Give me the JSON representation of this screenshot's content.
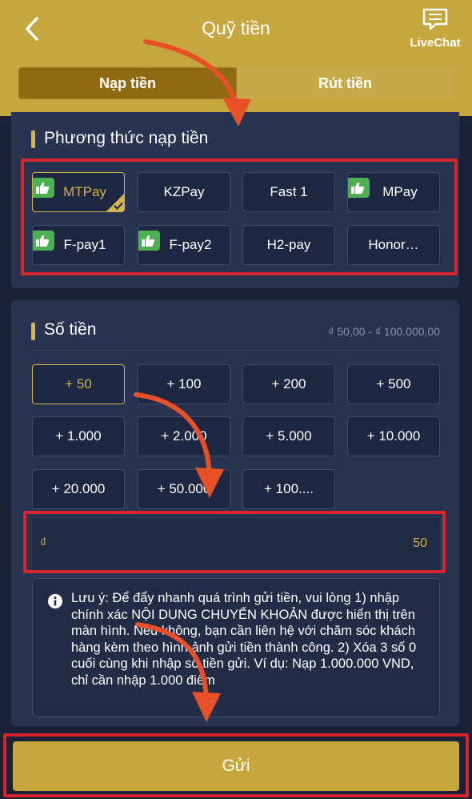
{
  "header": {
    "title": "Quỹ tiền",
    "livechat_label": "LiveChat"
  },
  "tabs": [
    {
      "label": "Nạp tiền",
      "active": true
    },
    {
      "label": "Rút tiền",
      "active": false
    }
  ],
  "methods": {
    "title": "Phương thức nạp tiền",
    "items": [
      {
        "label": "MTPay",
        "recommended": true,
        "selected": true
      },
      {
        "label": "KZPay",
        "recommended": false,
        "selected": false
      },
      {
        "label": "Fast 1",
        "recommended": false,
        "selected": false
      },
      {
        "label": "MPay",
        "recommended": true,
        "selected": false
      },
      {
        "label": "F-pay1",
        "recommended": true,
        "selected": false
      },
      {
        "label": "F-pay2",
        "recommended": true,
        "selected": false
      },
      {
        "label": "H2-pay",
        "recommended": false,
        "selected": false
      },
      {
        "label": "Honor…",
        "recommended": false,
        "selected": false
      }
    ]
  },
  "amount": {
    "title": "Số tiền",
    "range": "₫ 50,00 - ₫ 100.000,00",
    "presets": [
      "+ 50",
      "+ 100",
      "+ 200",
      "+ 500",
      "+ 1.000",
      "+ 2.000",
      "+ 5.000",
      "+ 10.000",
      "+ 20.000",
      "+ 50.000",
      "+ 100...."
    ],
    "selected_preset": "+ 50",
    "currency": "₫",
    "value": "50"
  },
  "notice": {
    "text": "Lưu ý: Để đẩy nhanh quá trình gửi tiền, vui lòng 1) nhập chính xác NỘI DUNG CHUYỂN KHOẢN được hiển thị trên màn hình. Nếu không, bạn cần liên hệ với chăm sóc khách hàng kèm theo hình ảnh gửi tiền thành công. 2) Xóa 3 số 0 cuối cùng khi nhập số tiền gửi. Ví dụ: Nạp 1.000.000 VND, chỉ cần nhập 1.000 điểm"
  },
  "submit_label": "Gửi",
  "colors": {
    "gold": "#c6a73f",
    "accent": "#d4b24c",
    "panel": "#283350",
    "background": "#1a2238",
    "highlight": "#d6252c",
    "arrow": "#e8502a",
    "thumb_badge": "#4caf50"
  }
}
